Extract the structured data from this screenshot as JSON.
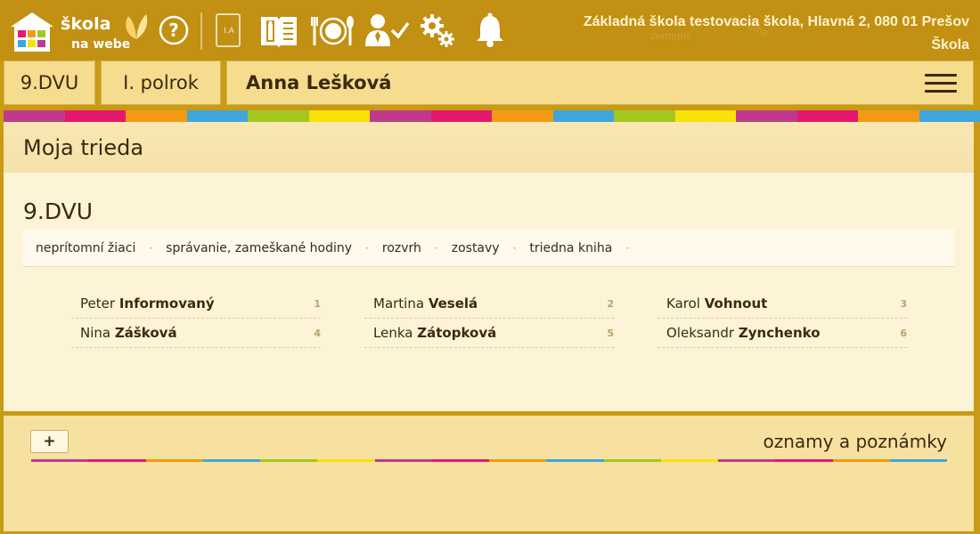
{
  "app": {
    "logo_line1": "škola",
    "logo_line2": "na webe",
    "school_name": "Základná škola testovacia škola, Hlavná 2, 080 01 Prešov",
    "role": "Škola",
    "icons": [
      "help-icon",
      "class-book-icon",
      "info-book-icon",
      "meal-icon",
      "teacher-check-icon",
      "settings-icon",
      "bell-icon"
    ],
    "book_label": "I.A"
  },
  "header": {
    "class_label": "9.DVU",
    "term_label": "I. polrok",
    "student_name": "Anna Lešková"
  },
  "stripe_colors": [
    "#c03a8b",
    "#e5176f",
    "#f39a12",
    "#3fa6dd",
    "#a3c721",
    "#f7e20a",
    "#c03a8b",
    "#e5176f",
    "#f39a12",
    "#3fa6dd",
    "#a3c721",
    "#f7e20a",
    "#c03a8b",
    "#e5176f",
    "#f39a12",
    "#3fa6dd"
  ],
  "main": {
    "panel_title": "Moja trieda",
    "class_title": "9.DVU",
    "subnav": [
      "neprítomní žiaci",
      "správanie, zameškané hodiny",
      "rozvrh",
      "zostavy",
      "triedna kniha"
    ],
    "students": [
      {
        "first": "Peter",
        "last": "Informovaný",
        "num": "1"
      },
      {
        "first": "Martina",
        "last": "Veselá",
        "num": "2"
      },
      {
        "first": "Karol",
        "last": "Vohnout",
        "num": "3"
      },
      {
        "first": "Nina",
        "last": "Zášková",
        "num": "4"
      },
      {
        "first": "Lenka",
        "last": "Zátopková",
        "num": "5"
      },
      {
        "first": "Oleksandr",
        "last": "Zynchenko",
        "num": "6"
      }
    ]
  },
  "notes": {
    "add_label": "+",
    "title": "oznamy a poznámky"
  }
}
